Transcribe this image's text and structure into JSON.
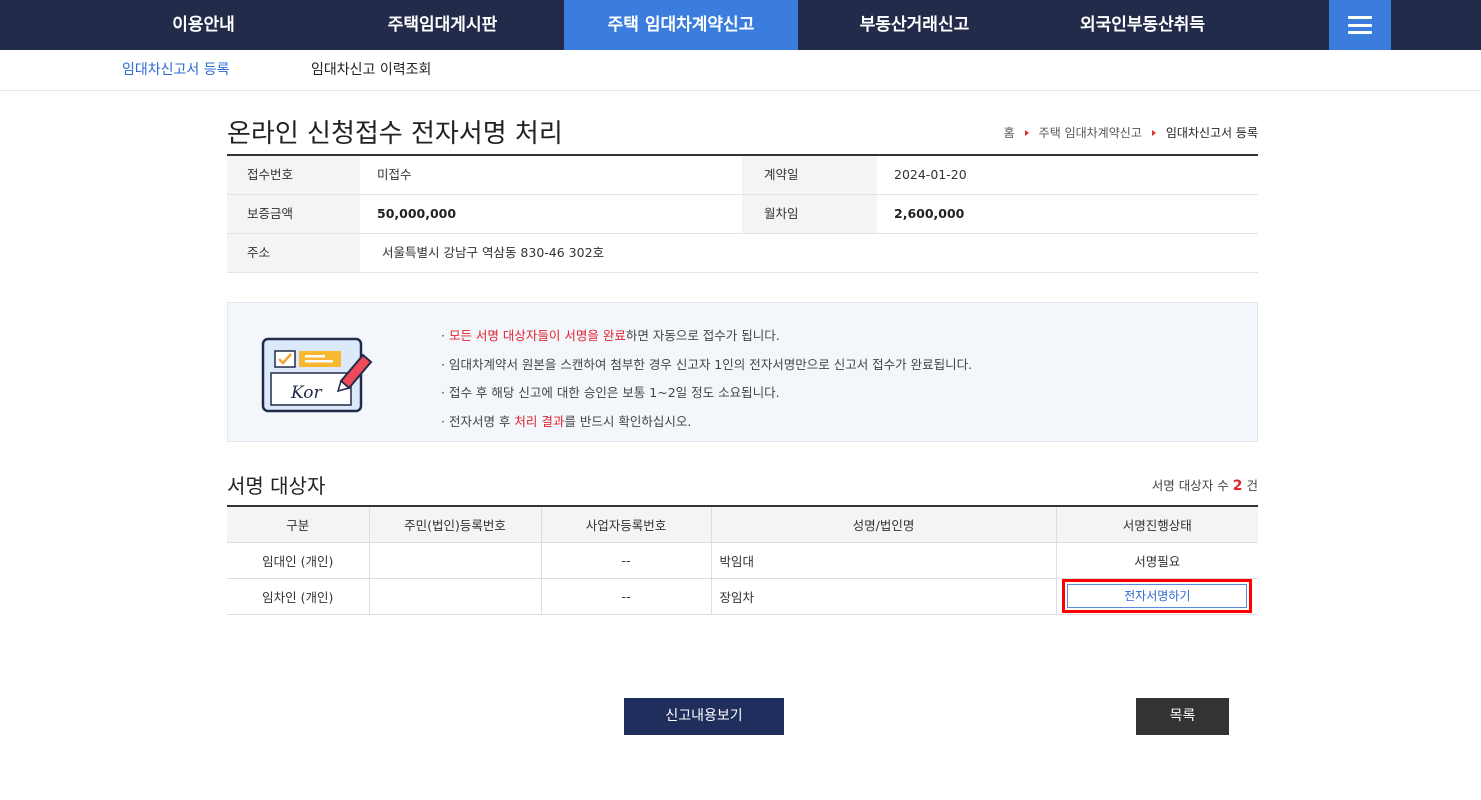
{
  "nav": {
    "items": [
      {
        "label": "이용안내"
      },
      {
        "label": "주택임대게시판"
      },
      {
        "label": "주택 임대차계약신고"
      },
      {
        "label": "부동산거래신고"
      },
      {
        "label": "외국인부동산취득"
      }
    ],
    "active_index": 2
  },
  "subnav": {
    "items": [
      {
        "label": "임대차신고서 등록"
      },
      {
        "label": "임대차신고 이력조회"
      }
    ]
  },
  "page": {
    "title": "온라인 신청접수 전자서명 처리",
    "breadcrumb": [
      "홈",
      "주택 임대차계약신고",
      "임대차신고서 등록"
    ]
  },
  "info": {
    "receipt_no_label": "접수번호",
    "receipt_no_value": "미접수",
    "contract_date_label": "계약일",
    "contract_date_value": "2024-01-20",
    "deposit_label": "보증금액",
    "deposit_value": "50,000,000",
    "monthly_rent_label": "월차임",
    "monthly_rent_value": "2,600,000",
    "address_label": "주소",
    "address_value": "서울특별시 강남구 역삼동 830-46 302호"
  },
  "notice": {
    "line1_prefix": "· ",
    "line1_red": "모든 서명 대상자들이 서명을 완료",
    "line1_suffix": "하면 자동으로 접수가 됩니다.",
    "line2": "· 임대차계약서 원본을 스캔하여 첨부한 경우 신고자 1인의 전자서명만으로 신고서 접수가 완료됩니다.",
    "line3": "· 접수 후 해당 신고에 대한 승인은 보통 1~2일 정도 소요됩니다.",
    "line4_prefix": "· 전자서명 후 ",
    "line4_red": "처리 결과",
    "line4_suffix": "를 반드시 확인하십시오.",
    "illust_text": "Kor"
  },
  "signers": {
    "title": "서명 대상자",
    "count_label": "서명 대상자 수",
    "count": "2",
    "count_unit": "건",
    "headers": [
      "구분",
      "주민(법인)등록번호",
      "사업자등록번호",
      "성명/법인명",
      "서명진행상태"
    ],
    "rows": [
      {
        "type": "임대인 (개인)",
        "resident_no": "",
        "business_no": "--",
        "name": "박임대",
        "status": "서명필요"
      },
      {
        "type": "임차인 (개인)",
        "resident_no": "",
        "business_no": "--",
        "name": "장임차",
        "status": "전자서명하기"
      }
    ]
  },
  "buttons": {
    "view": "신고내용보기",
    "list": "목록"
  },
  "colors": {
    "nav_bg": "#222b4a",
    "nav_active": "#3b7ddd",
    "accent_red": "#e0252e",
    "link_blue": "#2d6bd0"
  }
}
